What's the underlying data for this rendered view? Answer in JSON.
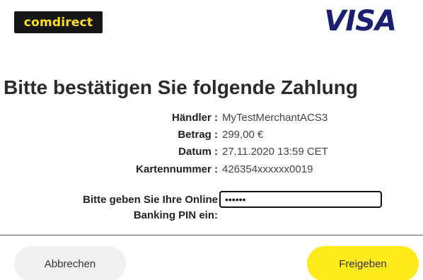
{
  "header": {
    "brand_logo": "comdirect",
    "card_logo": "VISA"
  },
  "title": "Bitte bestätigen Sie folgende Zahlung",
  "details": [
    {
      "label": "Händler :",
      "value": "MyTestMerchantACS3"
    },
    {
      "label": "Betrag :",
      "value": "299,00 €"
    },
    {
      "label": "Datum :",
      "value": "27.11.2020 13:59 CET"
    },
    {
      "label": "Kartennummer :",
      "value": "426354xxxxxx0019"
    }
  ],
  "pin": {
    "label_line1": "Bitte geben Sie Ihre Online",
    "label_line2": "Banking PIN ein:",
    "value": "••••••"
  },
  "buttons": {
    "cancel_label": "Abbrechen",
    "confirm_label": "Freigeben"
  },
  "colors": {
    "brand_yellow": "#ffe11a",
    "brand_black": "#151515",
    "visa_blue": "#1a1f71",
    "confirm_button": "#ffeb1b",
    "cancel_button": "#f1f1f1"
  }
}
